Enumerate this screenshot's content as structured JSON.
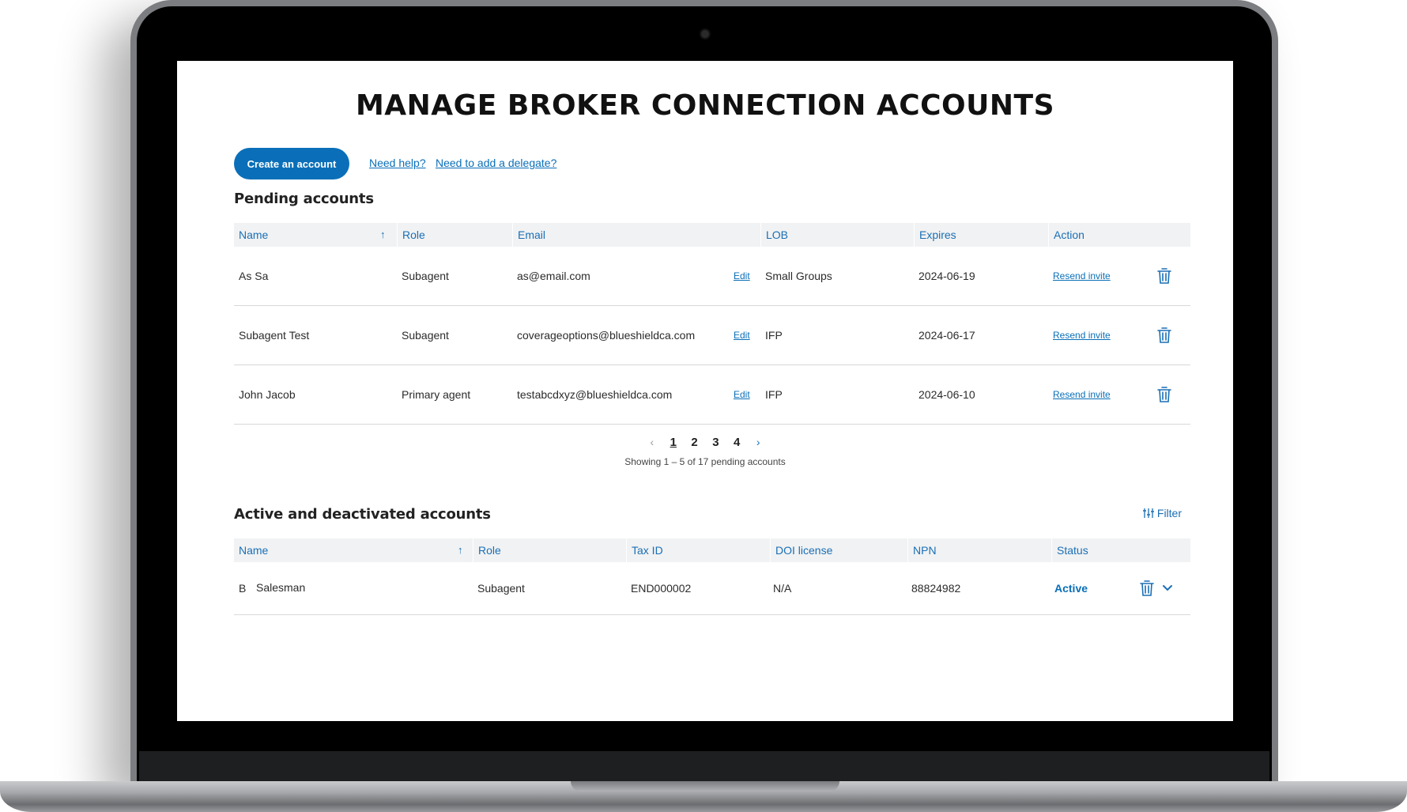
{
  "page": {
    "title": "MANAGE BROKER CONNECTION ACCOUNTS",
    "create_button": "Create an account",
    "help_link": "Need help?",
    "delegate_link": "Need to add a delegate?"
  },
  "pending": {
    "title": "Pending accounts",
    "columns": [
      "Name",
      "Role",
      "Email",
      "LOB",
      "Expires",
      "Action"
    ],
    "sort_icon": "arrow-up-icon",
    "rows": [
      {
        "name": "As Sa",
        "role": "Subagent",
        "email": "as@email.com",
        "edit": "Edit",
        "lob": "Small Groups",
        "expires": "2024-06-19",
        "action": "Resend invite"
      },
      {
        "name": "Subagent Test",
        "role": "Subagent",
        "email": "coverageoptions@blueshieldca.com",
        "edit": "Edit",
        "lob": "IFP",
        "expires": "2024-06-17",
        "action": "Resend invite"
      },
      {
        "name": "John Jacob",
        "role": "Primary agent",
        "email": "testabcdxyz@blueshieldca.com",
        "edit": "Edit",
        "lob": "IFP",
        "expires": "2024-06-10",
        "action": "Resend invite"
      }
    ],
    "pagination": {
      "prev": "‹",
      "pages": [
        "1",
        "2",
        "3",
        "4"
      ],
      "current": "1",
      "next": "›",
      "showing": "Showing 1 – 5 of 17 pending accounts"
    }
  },
  "active": {
    "title": "Active and deactivated accounts",
    "filter_label": "Filter",
    "filter_icon": "sliders-icon",
    "columns": [
      "Name",
      "Role",
      "Tax ID",
      "DOI license",
      "NPN",
      "Status"
    ],
    "rows": [
      {
        "initial": "B",
        "name": "Salesman",
        "role": "Subagent",
        "tax_id": "END000002",
        "doi": "N/A",
        "npn": "88824982",
        "status": "Active"
      }
    ]
  },
  "colors": {
    "accent": "#0a6fb8",
    "header_bg": "#f1f2f3",
    "header_text": "#1a6fb5"
  }
}
